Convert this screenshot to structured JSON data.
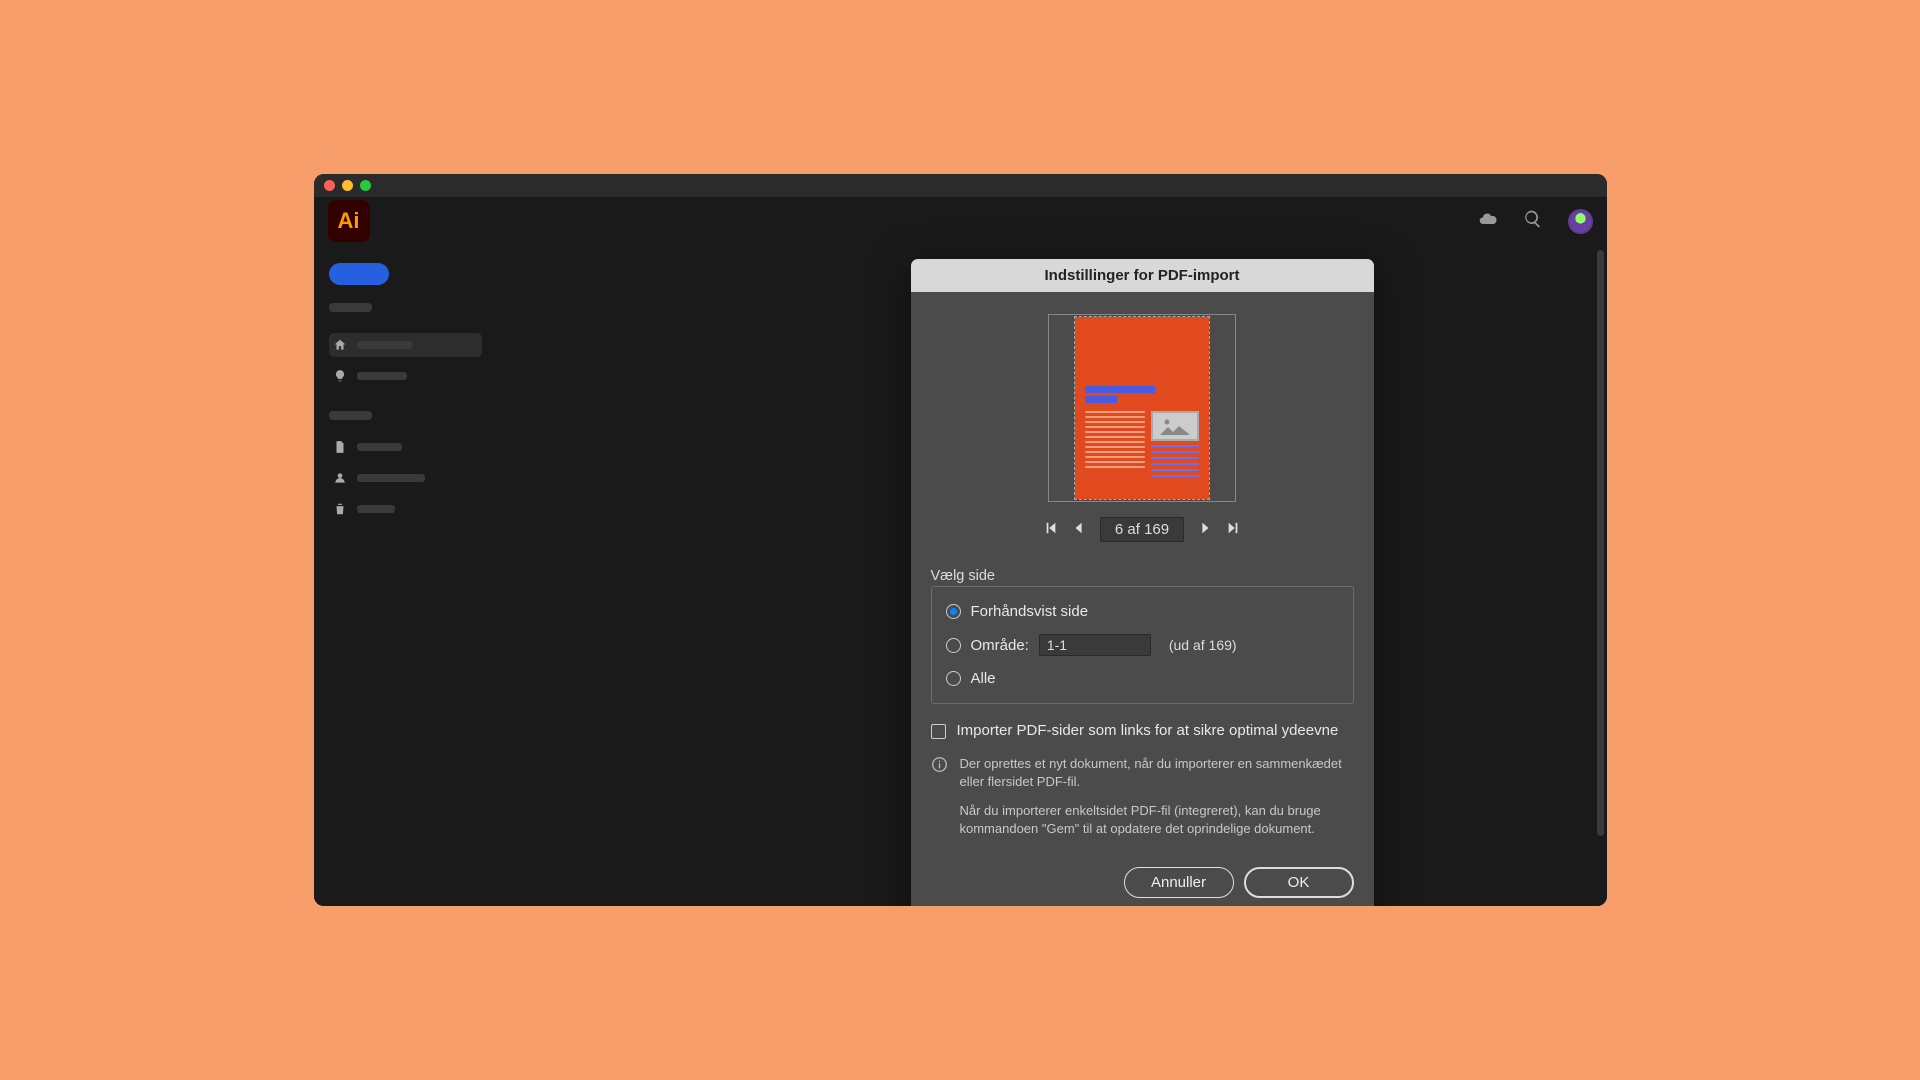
{
  "topbar": {
    "app_short": "Ai"
  },
  "dialog": {
    "title": "Indstillinger for PDF-import",
    "pager": {
      "label": "6 af 169"
    },
    "group_label": "Vælg side",
    "radio_preview": "Forhåndsvist side",
    "radio_range": "Område:",
    "range_value": "1-1",
    "range_suffix": "(ud af 169)",
    "radio_all": "Alle",
    "checkbox_label": "Importer PDF-sider som links for at sikre optimal ydeevne",
    "info_p1": "Der oprettes et nyt dokument, når du importerer en sammenkædet eller flersidet PDF-fil.",
    "info_p2": "Når du importerer enkeltsidet PDF-fil (integreret), kan du bruge kommandoen \"Gem\" til at opdatere det oprindelige dokument.",
    "cancel": "Annuller",
    "ok": "OK"
  }
}
